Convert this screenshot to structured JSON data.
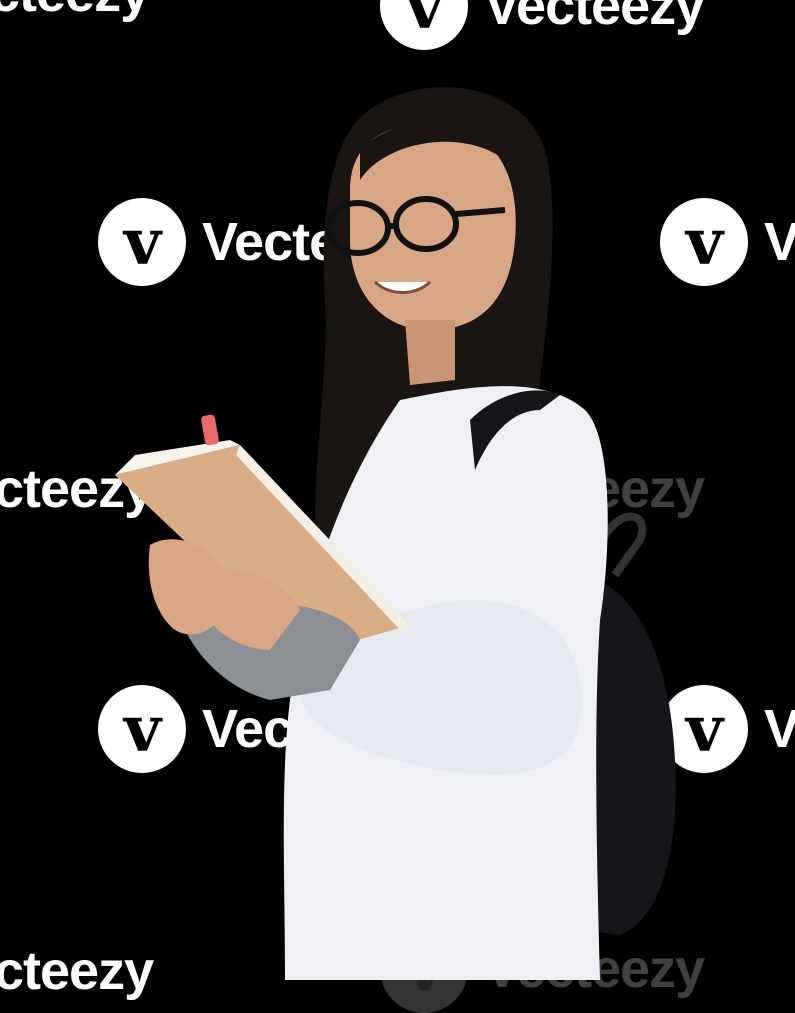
{
  "image": {
    "subject": "girl-with-glasses-holding-notebook",
    "background_color": "#000000"
  },
  "watermark": {
    "brand": "Vecteezy",
    "partial_left": "cteezy",
    "partial_right": "V",
    "partial_mid": "Vecte",
    "logo_glyph": "v"
  },
  "colors": {
    "shirt": "#eef0f5",
    "sleeve": "#8c8f93",
    "hair": "#1a1512",
    "skin": "#d9a685",
    "notebook": "#d9ad86",
    "backpack": "#15161a"
  }
}
